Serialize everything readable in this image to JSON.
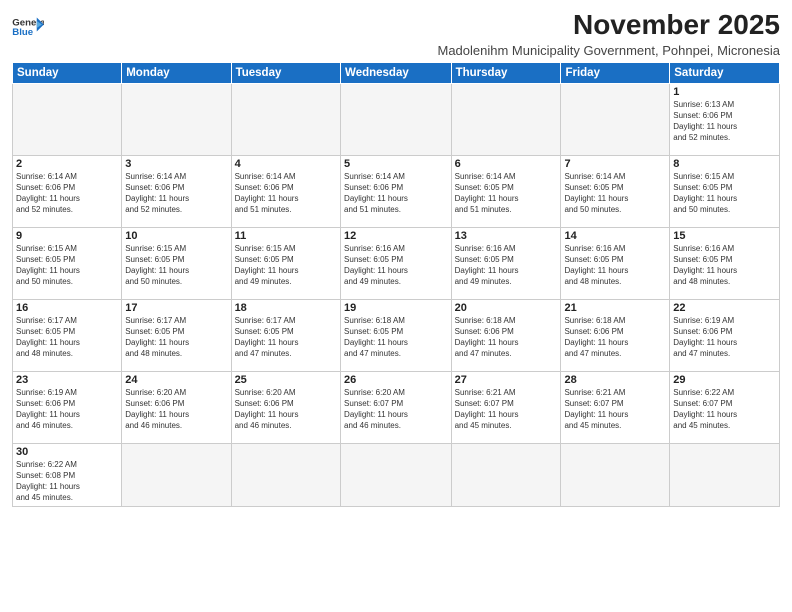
{
  "header": {
    "logo_line1": "General",
    "logo_line2": "Blue",
    "month_title": "November 2025",
    "subtitle": "Madolenihm Municipality Government, Pohnpei, Micronesia"
  },
  "days_of_week": [
    "Sunday",
    "Monday",
    "Tuesday",
    "Wednesday",
    "Thursday",
    "Friday",
    "Saturday"
  ],
  "weeks": [
    {
      "days": [
        {
          "num": "",
          "info": ""
        },
        {
          "num": "",
          "info": ""
        },
        {
          "num": "",
          "info": ""
        },
        {
          "num": "",
          "info": ""
        },
        {
          "num": "",
          "info": ""
        },
        {
          "num": "",
          "info": ""
        },
        {
          "num": "1",
          "info": "Sunrise: 6:13 AM\nSunset: 6:06 PM\nDaylight: 11 hours\nand 52 minutes."
        }
      ]
    },
    {
      "days": [
        {
          "num": "2",
          "info": "Sunrise: 6:14 AM\nSunset: 6:06 PM\nDaylight: 11 hours\nand 52 minutes."
        },
        {
          "num": "3",
          "info": "Sunrise: 6:14 AM\nSunset: 6:06 PM\nDaylight: 11 hours\nand 52 minutes."
        },
        {
          "num": "4",
          "info": "Sunrise: 6:14 AM\nSunset: 6:06 PM\nDaylight: 11 hours\nand 51 minutes."
        },
        {
          "num": "5",
          "info": "Sunrise: 6:14 AM\nSunset: 6:06 PM\nDaylight: 11 hours\nand 51 minutes."
        },
        {
          "num": "6",
          "info": "Sunrise: 6:14 AM\nSunset: 6:05 PM\nDaylight: 11 hours\nand 51 minutes."
        },
        {
          "num": "7",
          "info": "Sunrise: 6:14 AM\nSunset: 6:05 PM\nDaylight: 11 hours\nand 50 minutes."
        },
        {
          "num": "8",
          "info": "Sunrise: 6:15 AM\nSunset: 6:05 PM\nDaylight: 11 hours\nand 50 minutes."
        }
      ]
    },
    {
      "days": [
        {
          "num": "9",
          "info": "Sunrise: 6:15 AM\nSunset: 6:05 PM\nDaylight: 11 hours\nand 50 minutes."
        },
        {
          "num": "10",
          "info": "Sunrise: 6:15 AM\nSunset: 6:05 PM\nDaylight: 11 hours\nand 50 minutes."
        },
        {
          "num": "11",
          "info": "Sunrise: 6:15 AM\nSunset: 6:05 PM\nDaylight: 11 hours\nand 49 minutes."
        },
        {
          "num": "12",
          "info": "Sunrise: 6:16 AM\nSunset: 6:05 PM\nDaylight: 11 hours\nand 49 minutes."
        },
        {
          "num": "13",
          "info": "Sunrise: 6:16 AM\nSunset: 6:05 PM\nDaylight: 11 hours\nand 49 minutes."
        },
        {
          "num": "14",
          "info": "Sunrise: 6:16 AM\nSunset: 6:05 PM\nDaylight: 11 hours\nand 48 minutes."
        },
        {
          "num": "15",
          "info": "Sunrise: 6:16 AM\nSunset: 6:05 PM\nDaylight: 11 hours\nand 48 minutes."
        }
      ]
    },
    {
      "days": [
        {
          "num": "16",
          "info": "Sunrise: 6:17 AM\nSunset: 6:05 PM\nDaylight: 11 hours\nand 48 minutes."
        },
        {
          "num": "17",
          "info": "Sunrise: 6:17 AM\nSunset: 6:05 PM\nDaylight: 11 hours\nand 48 minutes."
        },
        {
          "num": "18",
          "info": "Sunrise: 6:17 AM\nSunset: 6:05 PM\nDaylight: 11 hours\nand 47 minutes."
        },
        {
          "num": "19",
          "info": "Sunrise: 6:18 AM\nSunset: 6:05 PM\nDaylight: 11 hours\nand 47 minutes."
        },
        {
          "num": "20",
          "info": "Sunrise: 6:18 AM\nSunset: 6:06 PM\nDaylight: 11 hours\nand 47 minutes."
        },
        {
          "num": "21",
          "info": "Sunrise: 6:18 AM\nSunset: 6:06 PM\nDaylight: 11 hours\nand 47 minutes."
        },
        {
          "num": "22",
          "info": "Sunrise: 6:19 AM\nSunset: 6:06 PM\nDaylight: 11 hours\nand 47 minutes."
        }
      ]
    },
    {
      "days": [
        {
          "num": "23",
          "info": "Sunrise: 6:19 AM\nSunset: 6:06 PM\nDaylight: 11 hours\nand 46 minutes."
        },
        {
          "num": "24",
          "info": "Sunrise: 6:20 AM\nSunset: 6:06 PM\nDaylight: 11 hours\nand 46 minutes."
        },
        {
          "num": "25",
          "info": "Sunrise: 6:20 AM\nSunset: 6:06 PM\nDaylight: 11 hours\nand 46 minutes."
        },
        {
          "num": "26",
          "info": "Sunrise: 6:20 AM\nSunset: 6:07 PM\nDaylight: 11 hours\nand 46 minutes."
        },
        {
          "num": "27",
          "info": "Sunrise: 6:21 AM\nSunset: 6:07 PM\nDaylight: 11 hours\nand 45 minutes."
        },
        {
          "num": "28",
          "info": "Sunrise: 6:21 AM\nSunset: 6:07 PM\nDaylight: 11 hours\nand 45 minutes."
        },
        {
          "num": "29",
          "info": "Sunrise: 6:22 AM\nSunset: 6:07 PM\nDaylight: 11 hours\nand 45 minutes."
        }
      ]
    },
    {
      "days": [
        {
          "num": "30",
          "info": "Sunrise: 6:22 AM\nSunset: 6:08 PM\nDaylight: 11 hours\nand 45 minutes."
        },
        {
          "num": "",
          "info": ""
        },
        {
          "num": "",
          "info": ""
        },
        {
          "num": "",
          "info": ""
        },
        {
          "num": "",
          "info": ""
        },
        {
          "num": "",
          "info": ""
        },
        {
          "num": "",
          "info": ""
        }
      ]
    }
  ]
}
